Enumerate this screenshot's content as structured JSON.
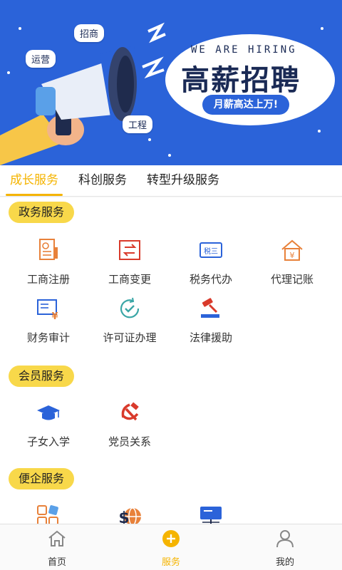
{
  "banner": {
    "tagline": "WE ARE HIRING",
    "headline": "高薪招聘",
    "pill": "月薪高达上万!",
    "tags": [
      "招商",
      "运营",
      "工程"
    ]
  },
  "tabs": [
    {
      "label": "成长服务",
      "active": true
    },
    {
      "label": "科创服务",
      "active": false
    },
    {
      "label": "转型升级服务",
      "active": false
    }
  ],
  "sections": {
    "gov": {
      "title": "政务服务",
      "items": [
        "工商注册",
        "工商变更",
        "税务代办",
        "代理记账",
        "财务审计",
        "许可证办理",
        "法律援助"
      ]
    },
    "member": {
      "title": "会员服务",
      "items": [
        "子女入学",
        "党员关系"
      ]
    },
    "biz": {
      "title": "便企服务",
      "items": [
        "",
        "",
        ""
      ]
    }
  },
  "bottom_nav": [
    {
      "label": "首页",
      "icon": "home-icon",
      "active": false
    },
    {
      "label": "服务",
      "icon": "plus-icon",
      "active": true
    },
    {
      "label": "我的",
      "icon": "user-icon",
      "active": false
    }
  ],
  "colors": {
    "accent": "#f5b400",
    "banner_bg": "#2b63d9",
    "section_pill": "#f8d84a"
  }
}
